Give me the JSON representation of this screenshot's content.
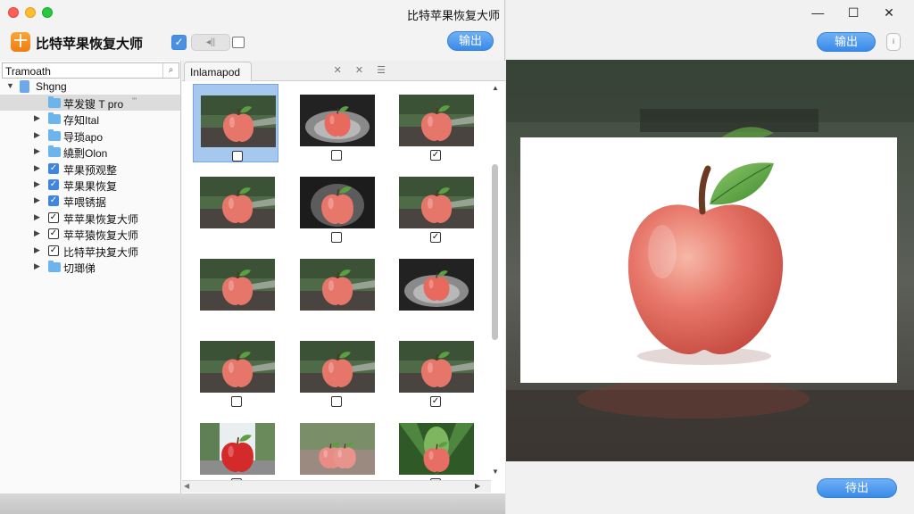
{
  "left_window": {
    "title": "比特苹果恢复大师",
    "app_name": "比特苹果恢复大师",
    "toolbar": {
      "seg_label": "◂||",
      "export_label": "输出"
    },
    "tree": {
      "search_value": "Tramoath",
      "device_label": "Shgng",
      "items": [
        {
          "label": "苹发锼 T pro",
          "extra": "'''",
          "state": "folder",
          "selected": true
        },
        {
          "label": "存知Ital",
          "state": "folder"
        },
        {
          "label": "导琐apo",
          "state": "folder"
        },
        {
          "label": "繞剽Olon",
          "state": "folder"
        },
        {
          "label": "苹果预观整",
          "state": "checked-blue"
        },
        {
          "label": "苹果果恢复",
          "state": "checked-blue"
        },
        {
          "label": "苹喂锈据",
          "state": "checked-blue"
        },
        {
          "label": "苹苹果恢复大师",
          "state": "checked"
        },
        {
          "label": "苹苹猿恢复大师",
          "state": "checked"
        },
        {
          "label": "比特苹抉复大师",
          "state": "checked"
        },
        {
          "label": "切瑯俤",
          "state": "folder"
        }
      ]
    },
    "grid": {
      "tab_label": "Inlamapod",
      "tab_icons": "✕ ✕ ☰",
      "thumbnails": [
        {
          "style": "garden",
          "check": "",
          "selected": true
        },
        {
          "style": "spot",
          "check": ""
        },
        {
          "style": "garden",
          "check": "✓"
        },
        {
          "style": "garden",
          "check": "none"
        },
        {
          "style": "dark",
          "check": ""
        },
        {
          "style": "garden",
          "check": "✓"
        },
        {
          "style": "garden",
          "check": "none"
        },
        {
          "style": "garden",
          "check": "none"
        },
        {
          "style": "spot",
          "check": "none"
        },
        {
          "style": "garden",
          "check": ""
        },
        {
          "style": "garden",
          "check": ""
        },
        {
          "style": "garden",
          "check": "✓"
        },
        {
          "style": "red",
          "check": ""
        },
        {
          "style": "pair",
          "check": "none"
        },
        {
          "style": "leaf",
          "check": ""
        }
      ]
    }
  },
  "right_window": {
    "controls": {
      "minimize": "—",
      "maximize": "☐",
      "close": "✕"
    },
    "export_top_label": "输出",
    "info_label": "i",
    "export_bottom_label": "待出"
  },
  "colors": {
    "accent": "#3a8ae8",
    "apple": "#e2574c",
    "leaf": "#5aa040"
  }
}
